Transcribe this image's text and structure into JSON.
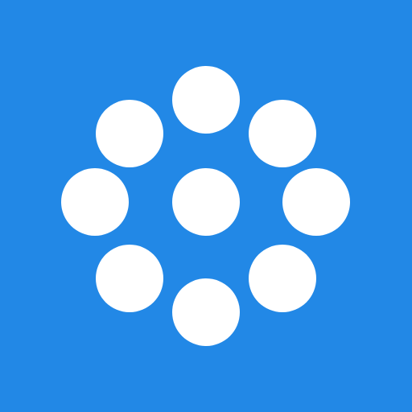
{
  "icon": {
    "name": "dots-cluster-icon",
    "background_color": "#2288E6",
    "dot_color": "#FFFFFF",
    "dot_count": 9
  }
}
